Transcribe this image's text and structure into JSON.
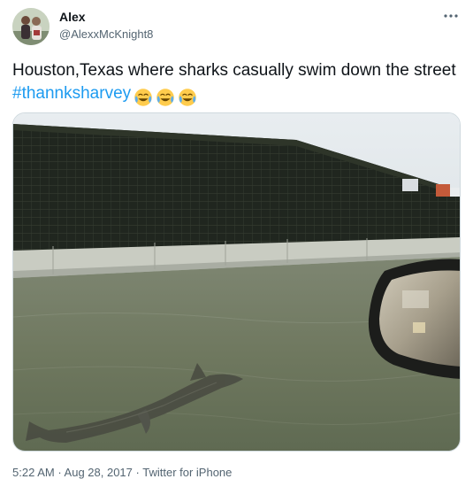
{
  "user": {
    "display_name": "Alex",
    "handle": "@AlexxMcKnight8"
  },
  "tweet": {
    "text": "Houston,Texas where sharks casually swim down the street ",
    "hashtag": "#thannksharvey",
    "emoji_count": 3,
    "emoji_name": "face-with-tears-of-joy-icon"
  },
  "meta": {
    "time": "5:22 AM",
    "separator": " · ",
    "date": "Aug 28, 2017",
    "source": "Twitter for iPhone"
  },
  "colors": {
    "link": "#1d9bf0",
    "secondary_text": "#536471",
    "primary_text": "#0f1419"
  }
}
